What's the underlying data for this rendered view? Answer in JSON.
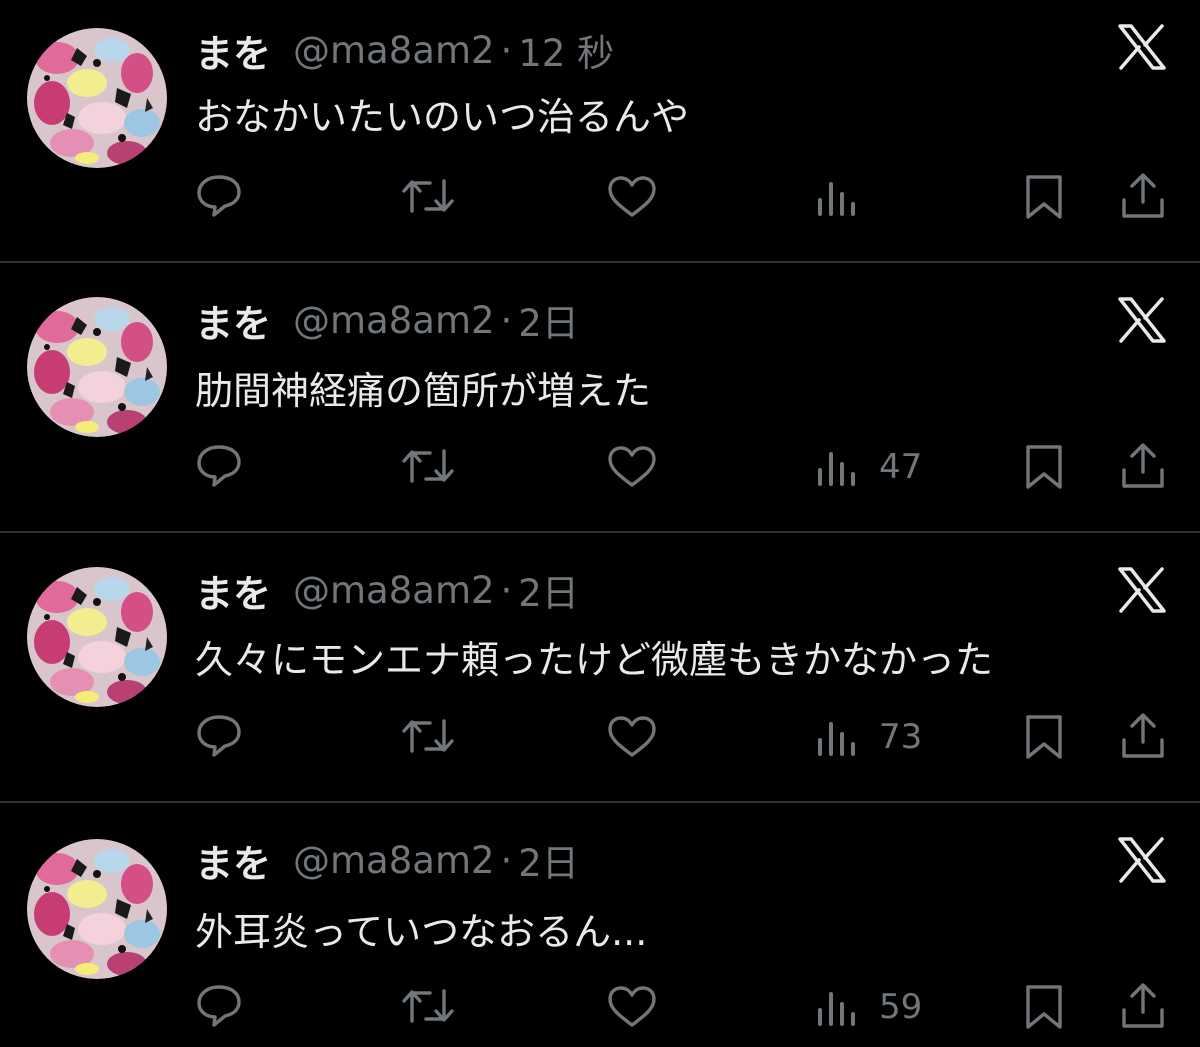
{
  "tweets": [
    {
      "name": "まを",
      "handle": "@ma8am2",
      "time": "12 秒",
      "text": "おなかいたいのいつ治るんや",
      "views": ""
    },
    {
      "name": "まを",
      "handle": "@ma8am2",
      "time": "2日",
      "text": "肋間神経痛の箇所が増えた",
      "views": "47"
    },
    {
      "name": "まを",
      "handle": "@ma8am2",
      "time": "2日",
      "text": "久々にモンエナ頼ったけど微塵もきかなかった",
      "views": "73"
    },
    {
      "name": "まを",
      "handle": "@ma8am2",
      "time": "2日",
      "text": "外耳炎っていつなおるん...",
      "views": "59"
    }
  ],
  "separator": "·",
  "icons": [
    "x-logo-icon",
    "reply-icon",
    "retweet-icon",
    "like-icon",
    "views-icon",
    "bookmark-icon",
    "share-icon"
  ],
  "colors": {
    "background": "#000000",
    "text": "#e7e9ea",
    "secondary": "#71767b",
    "divider": "#2f3336"
  }
}
